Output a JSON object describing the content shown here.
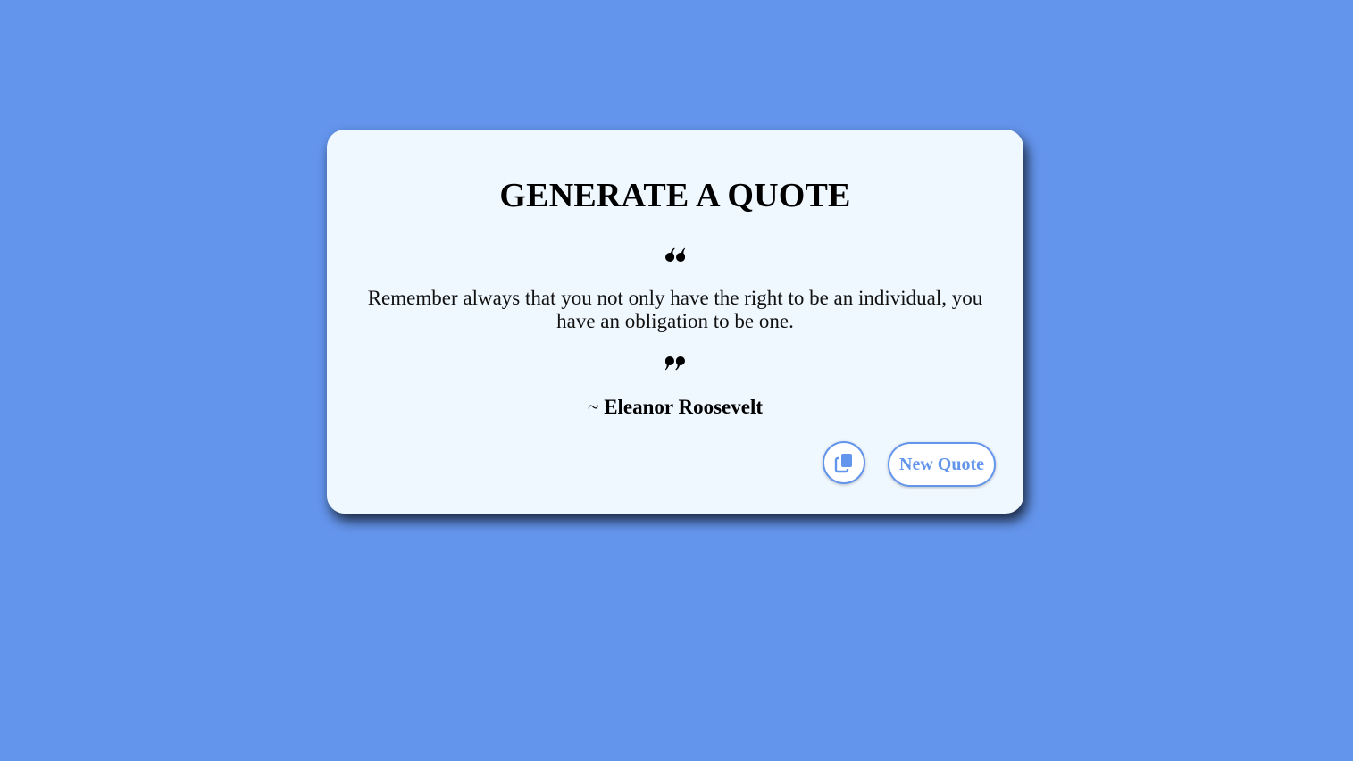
{
  "header": {
    "title": "GENERATE A QUOTE"
  },
  "quote": {
    "text": "Remember always that you not only have the right to be an individual, you have an obligation to be one.",
    "author_prefix": "~ ",
    "author": "Eleanor Roosevelt",
    "open_icon": "quote-left-icon",
    "close_icon": "quote-right-icon"
  },
  "actions": {
    "copy_icon": "copy-icon",
    "new_quote_label": "New Quote"
  },
  "colors": {
    "background": "#6495ed",
    "card": "#f0f8ff",
    "accent": "#6495ed",
    "text": "#000000"
  }
}
